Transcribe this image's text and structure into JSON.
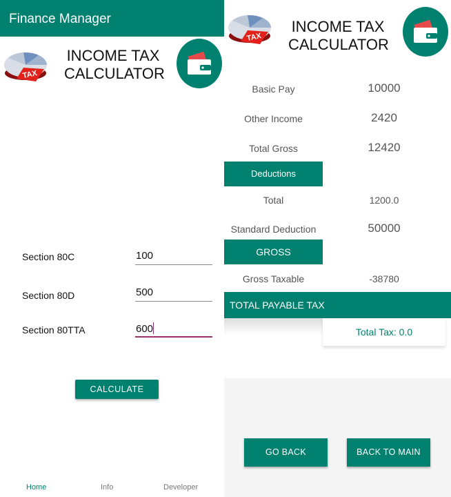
{
  "left": {
    "appbar_title": "Finance Manager",
    "header": {
      "line1": "INCOME TAX",
      "line2": "CALCULATOR"
    },
    "tax_logo_text": "TAX",
    "fields": [
      {
        "label": "Section 80C",
        "value": "100"
      },
      {
        "label": "Section 80D",
        "value": "500"
      },
      {
        "label": "Section 80TTA",
        "value": "600"
      }
    ],
    "calculate_label": "CALCULATE",
    "nav": [
      "Home",
      "Info",
      "Developer"
    ]
  },
  "right": {
    "header": {
      "line1": "INCOME TAX",
      "line2": "CALCULATOR"
    },
    "tax_logo_text": "TAX",
    "basic_pay_label": "Basic Pay",
    "basic_pay_value": "10000",
    "other_income_label": "Other Income",
    "other_income_value": "2420",
    "total_gross_label": "Total Gross",
    "total_gross_value": "12420",
    "deductions_label": "Deductions",
    "total_label": "Total",
    "total_value": "1200.0",
    "standard_deduction_label": "Standard Deduction",
    "standard_deduction_value": "50000",
    "gross_label": "GROSS",
    "gross_taxable_label": "Gross Taxable",
    "gross_taxable_value": "-38780",
    "total_payable_label": "TOTAL PAYABLE TAX",
    "total_tax_text": "Total Tax: 0.0",
    "go_back_label": "GO BACK",
    "back_to_main_label": "BACK TO MAIN"
  },
  "colors": {
    "primary": "#00806e",
    "accent": "#a3306b"
  },
  "icons": [
    "tax-pie-logo-icon",
    "wallet-icon"
  ]
}
